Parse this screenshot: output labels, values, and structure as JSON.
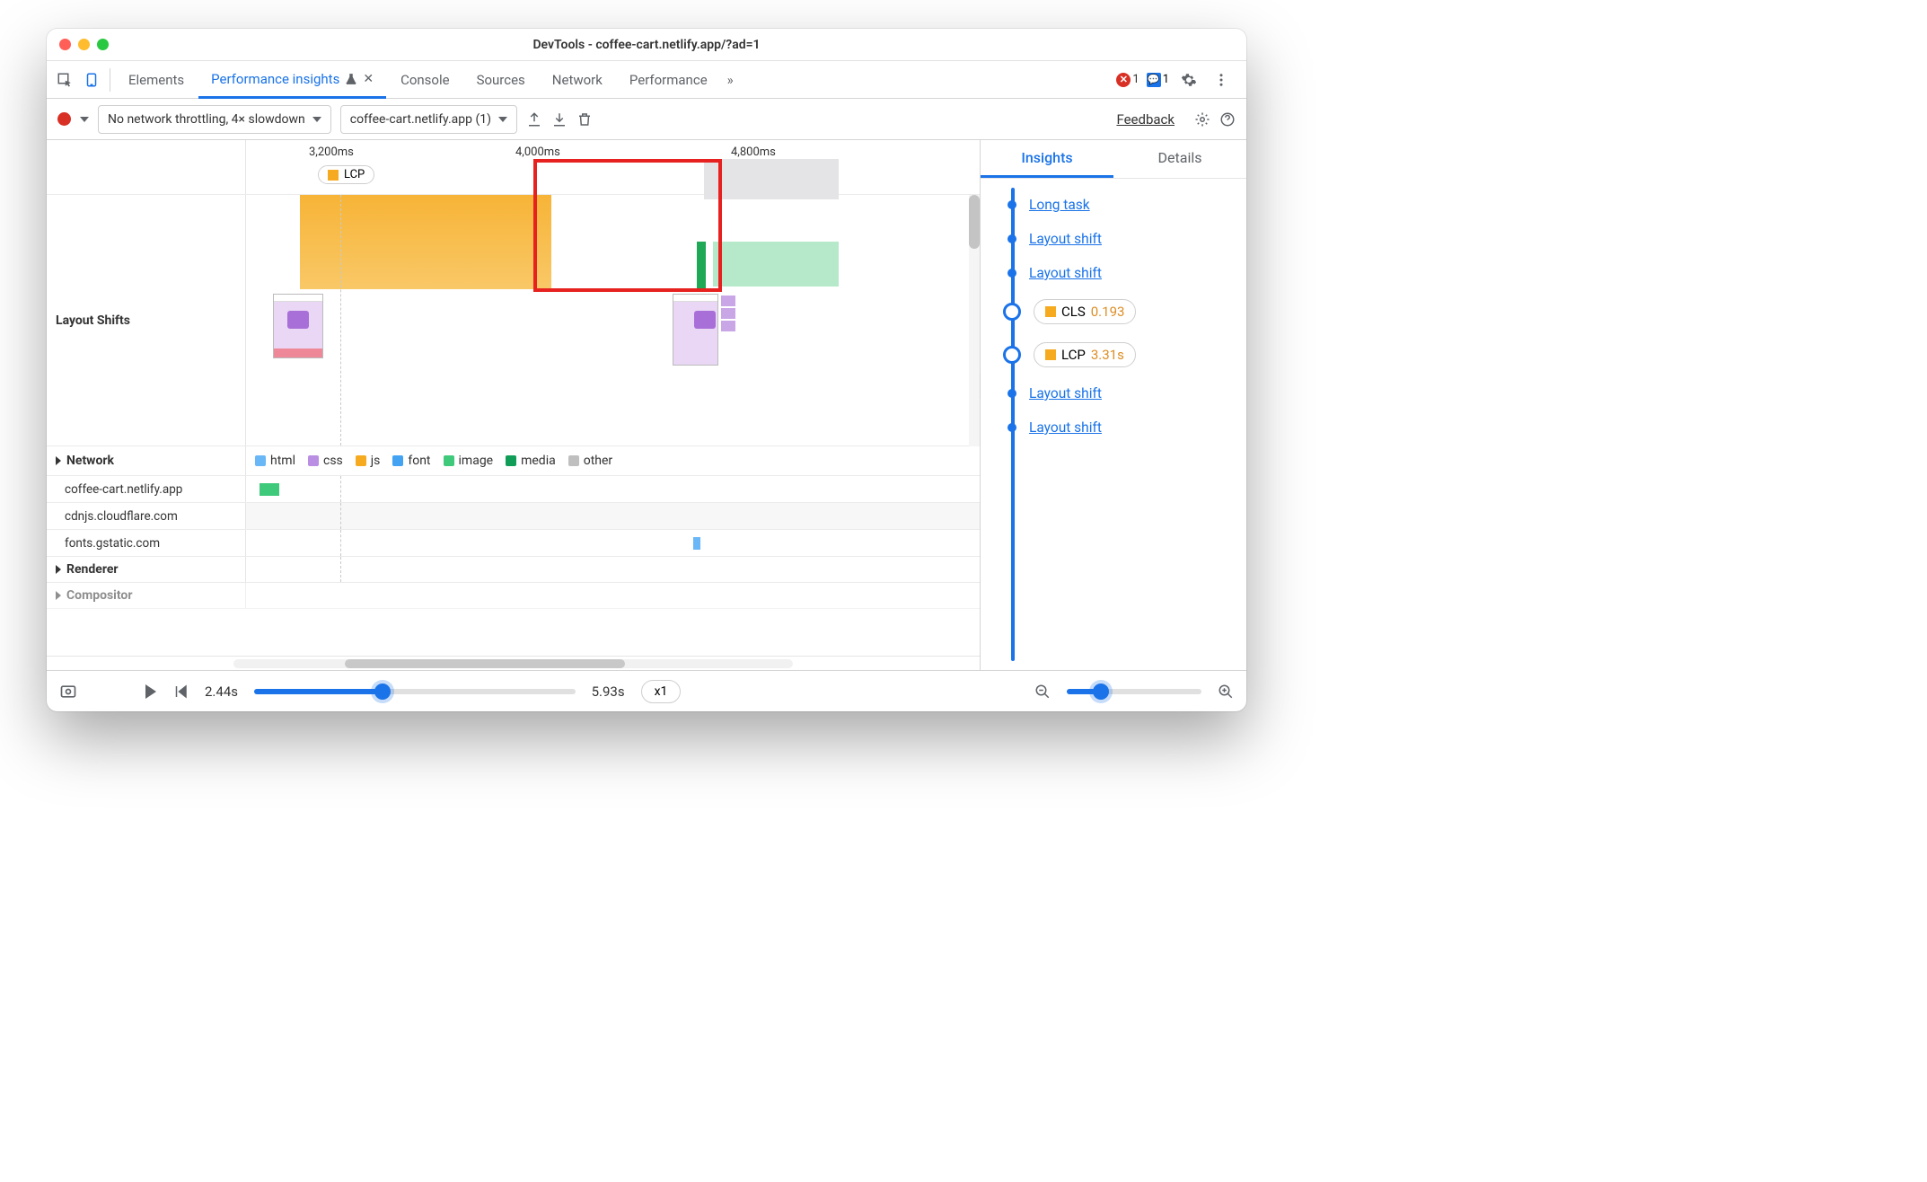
{
  "window": {
    "title": "DevTools - coffee-cart.netlify.app/?ad=1"
  },
  "tabs": {
    "elements": "Elements",
    "perf_insights": "Performance insights",
    "console": "Console",
    "sources": "Sources",
    "network": "Network",
    "performance": "Performance",
    "more_glyph": "»",
    "error_count": "1",
    "message_count": "1"
  },
  "toolbar": {
    "throttling": "No network throttling, 4× slowdown",
    "recording": "coffee-cart.netlify.app (1)",
    "feedback": "Feedback"
  },
  "ruler": {
    "ticks": [
      "3,200ms",
      "4,000ms",
      "4,800ms"
    ],
    "lcp_chip": "LCP"
  },
  "rows": {
    "layout_shifts": "Layout Shifts",
    "network": "Network",
    "renderer": "Renderer",
    "compositor": "Compositor"
  },
  "legend": {
    "html": "html",
    "css": "css",
    "js": "js",
    "font": "font",
    "image": "image",
    "media": "media",
    "other": "other"
  },
  "net_hosts": [
    "coffee-cart.netlify.app",
    "cdnjs.cloudflare.com",
    "fonts.gstatic.com"
  ],
  "right": {
    "tab_insights": "Insights",
    "tab_details": "Details",
    "items": [
      {
        "type": "link",
        "label": "Long task"
      },
      {
        "type": "link",
        "label": "Layout shift"
      },
      {
        "type": "link",
        "label": "Layout shift"
      },
      {
        "type": "chip",
        "metric": "CLS",
        "value": "0.193",
        "color": "or"
      },
      {
        "type": "chip",
        "metric": "LCP",
        "value": "3.31s",
        "color": "or"
      },
      {
        "type": "link",
        "label": "Layout shift"
      },
      {
        "type": "link",
        "label": "Layout shift"
      }
    ]
  },
  "footer": {
    "start": "2.44s",
    "end": "5.93s",
    "speed": "x1"
  }
}
